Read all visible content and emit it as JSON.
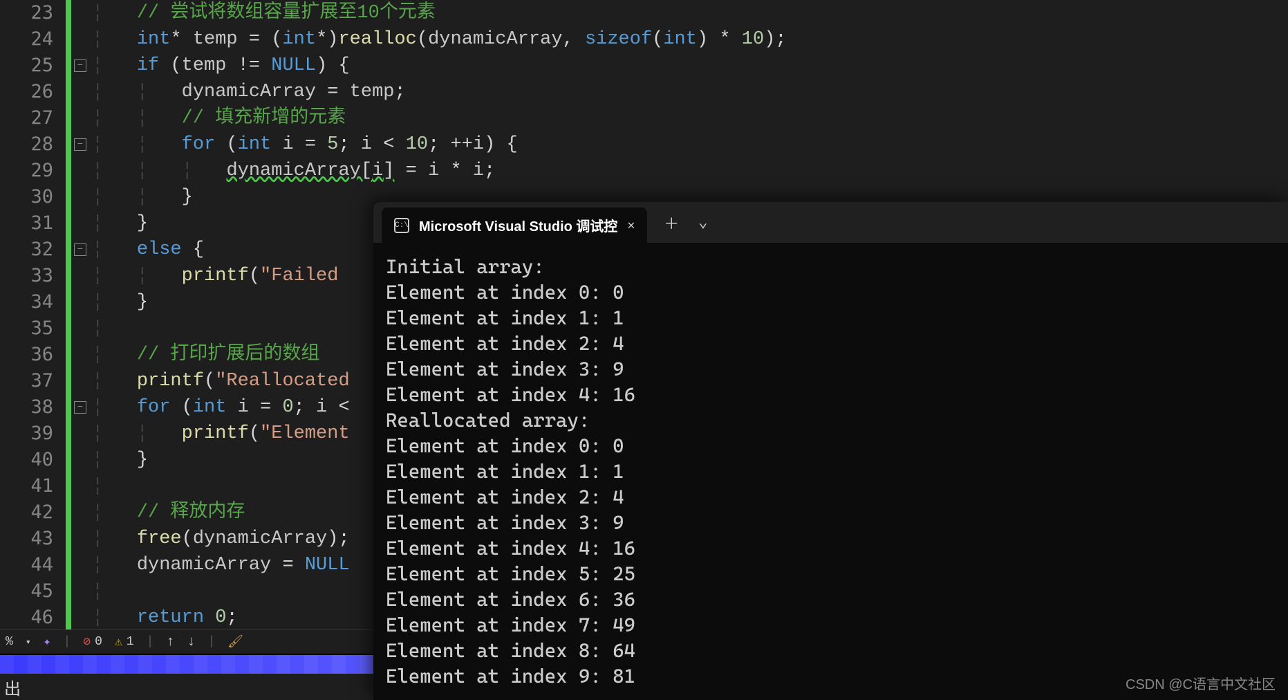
{
  "lines": [
    23,
    24,
    25,
    26,
    27,
    28,
    29,
    30,
    31,
    32,
    33,
    34,
    35,
    36,
    37,
    38,
    39,
    40,
    41,
    42,
    43,
    44,
    45,
    46
  ],
  "code": {
    "l23": "// 尝试将数组容量扩展至10个元素",
    "l24_int": "int",
    "l24_temp": "temp",
    "l24_realloc": "realloc",
    "l24_dyn": "dynamicArray",
    "l24_sizeof": "sizeof",
    "l24_num": "10",
    "l25_if": "if",
    "l25_temp": "temp",
    "l25_null": "NULL",
    "l26_dyn": "dynamicArray",
    "l26_temp": "temp",
    "l27": "// 填充新增的元素",
    "l28_for": "for",
    "l28_int": "int",
    "l28_i": "i",
    "l28_5": "5",
    "l28_10": "10",
    "l29_dyn": "dynamicArray",
    "l29_i": "i",
    "l32_else": "else",
    "l33_printf": "printf",
    "l33_str": "\"Failed",
    "l36": "// 打印扩展后的数组",
    "l37_printf": "printf",
    "l37_str": "\"Reallocated",
    "l38_for": "for",
    "l38_int": "int",
    "l38_i": "i",
    "l38_0": "0",
    "l39_printf": "printf",
    "l39_str": "\"Element",
    "l42": "// 释放内存",
    "l43_free": "free",
    "l43_dyn": "dynamicArray",
    "l44_dyn": "dynamicArray",
    "l44_null": "NULL",
    "l46_return": "return",
    "l46_0": "0"
  },
  "statusbar": {
    "percent": "%",
    "errors": "0",
    "warnings": "1"
  },
  "bottom_text": "出",
  "console": {
    "tab_title": "Microsoft Visual Studio 调试控",
    "output": "Initial array:\nElement at index 0: 0\nElement at index 1: 1\nElement at index 2: 4\nElement at index 3: 9\nElement at index 4: 16\nReallocated array:\nElement at index 0: 0\nElement at index 1: 1\nElement at index 2: 4\nElement at index 3: 9\nElement at index 4: 16\nElement at index 5: 25\nElement at index 6: 36\nElement at index 7: 49\nElement at index 8: 64\nElement at index 9: 81"
  },
  "watermark": "CSDN @C语言中文社区"
}
